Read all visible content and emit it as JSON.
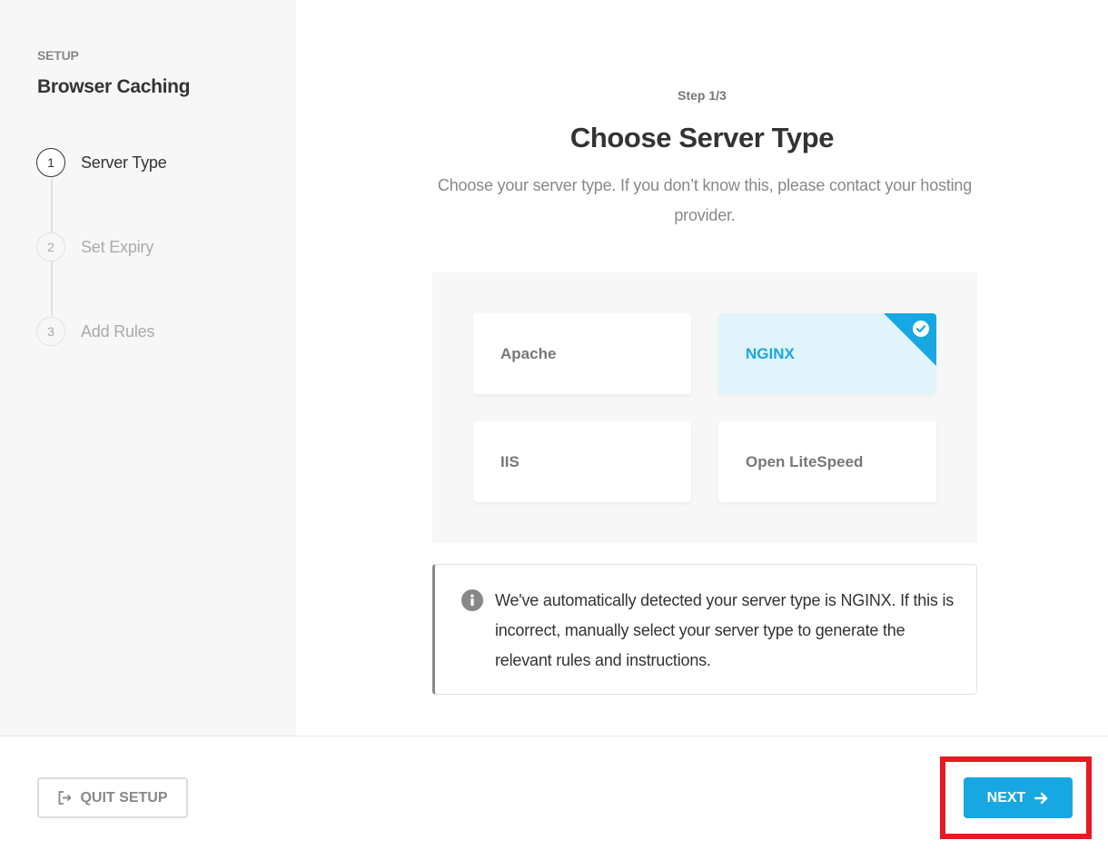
{
  "sidebar": {
    "section_label": "SETUP",
    "title": "Browser Caching",
    "steps": [
      {
        "number": "1",
        "label": "Server Type",
        "state": "active"
      },
      {
        "number": "2",
        "label": "Set Expiry",
        "state": "inactive"
      },
      {
        "number": "3",
        "label": "Add Rules",
        "state": "inactive"
      }
    ]
  },
  "main": {
    "step_indicator": "Step 1/3",
    "title": "Choose Server Type",
    "description": "Choose your server type. If you don’t know this, please contact your hosting provider.",
    "options": [
      {
        "label": "Apache",
        "selected": false
      },
      {
        "label": "NGINX",
        "selected": true,
        "icon": "check-circle-icon"
      },
      {
        "label": "IIS",
        "selected": false
      },
      {
        "label": "Open LiteSpeed",
        "selected": false
      }
    ],
    "notice": {
      "icon": "info-icon",
      "text": "We've automatically detected your server type is NGINX. If this is incorrect, manually select your server type to generate the relevant rules and instructions."
    }
  },
  "footer": {
    "quit_label": "QUIT SETUP",
    "quit_icon": "exit-icon",
    "next_label": "NEXT",
    "next_icon": "arrow-right-icon"
  },
  "colors": {
    "accent": "#17a8e3",
    "selected_bg": "#e1f4fc",
    "highlight_border": "#e41b23",
    "sidebar_bg": "#f7f7f7"
  }
}
